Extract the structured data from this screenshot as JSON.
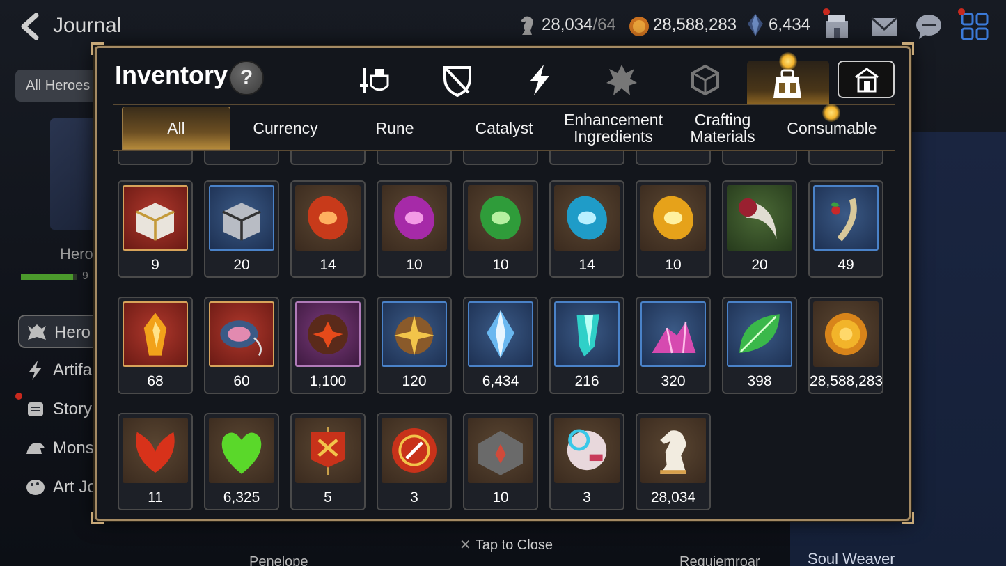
{
  "header": {
    "title": "Journal",
    "stamina": {
      "value": "28,034",
      "max": "/64"
    },
    "gold": "28,588,283",
    "skystone": "6,434"
  },
  "background": {
    "all_heroes": "All Heroes",
    "hero_label": "Hero",
    "hero_pct": "9",
    "sidebar": [
      "Hero",
      "Artifa",
      "Story",
      "Mons",
      "Art Jo"
    ],
    "bottom_heroes": [
      "Penelope",
      "Requiemroar"
    ],
    "right_label": "Soul Weaver"
  },
  "inventory": {
    "title": "Inventory",
    "help": "?",
    "subtabs": [
      "All",
      "Currency",
      "Rune",
      "Catalyst",
      "Enhancement Ingredients",
      "Crafting Materials",
      "Consumable"
    ],
    "rows": [
      [
        {
          "icon": "white-gold-chest",
          "count": "9"
        },
        {
          "icon": "silver-chest",
          "count": "20"
        },
        {
          "icon": "red-rune",
          "count": "14"
        },
        {
          "icon": "purple-rune",
          "count": "10"
        },
        {
          "icon": "green-rune",
          "count": "10"
        },
        {
          "icon": "blue-rune",
          "count": "14"
        },
        {
          "icon": "yellow-rune",
          "count": "10"
        },
        {
          "icon": "claw",
          "count": "20"
        },
        {
          "icon": "herb-root",
          "count": "49"
        }
      ],
      [
        {
          "icon": "flame-crystal",
          "count": "68"
        },
        {
          "icon": "coiled-charm",
          "count": "60"
        },
        {
          "icon": "flower-medal",
          "count": "1,100"
        },
        {
          "icon": "star-compass",
          "count": "120"
        },
        {
          "icon": "skystone",
          "count": "6,434"
        },
        {
          "icon": "cyan-crystal",
          "count": "216"
        },
        {
          "icon": "pink-gem-pile",
          "count": "320"
        },
        {
          "icon": "green-leaf",
          "count": "398"
        },
        {
          "icon": "gold-coin",
          "count": "28,588,283"
        }
      ],
      [
        {
          "icon": "red-leaf",
          "count": "11"
        },
        {
          "icon": "green-heart",
          "count": "6,325"
        },
        {
          "icon": "banner",
          "count": "5"
        },
        {
          "icon": "red-seal",
          "count": "3"
        },
        {
          "icon": "stone-block",
          "count": "10"
        },
        {
          "icon": "robot-pod",
          "count": "3"
        },
        {
          "icon": "chess-knight",
          "count": "28,034"
        }
      ]
    ]
  },
  "footer": {
    "tap_to_close": "Tap to Close"
  }
}
